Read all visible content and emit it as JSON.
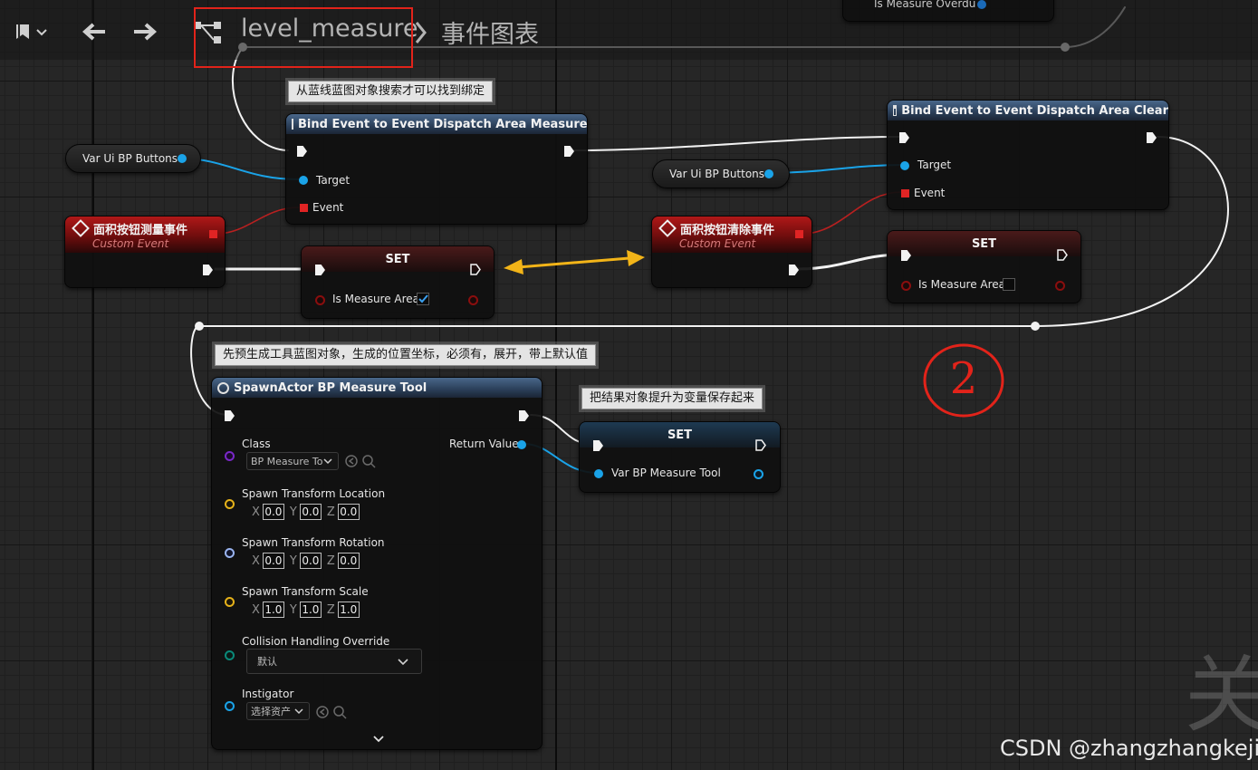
{
  "breadcrumb": {
    "blueprint_name": "level_measure",
    "graph_name": "事件图表"
  },
  "nodes": {
    "bind_measure": {
      "title": "Bind Event to Event Dispatch Area Measure",
      "pin_target": "Target",
      "pin_event": "Event",
      "comment": "从蓝线蓝图对象搜索才可以找到绑定"
    },
    "bind_clear": {
      "title": "Bind Event to Event Dispatch Area Clear",
      "pin_target": "Target",
      "pin_event": "Event"
    },
    "var_ui_1": {
      "label": "Var Ui BP Buttons"
    },
    "var_ui_2": {
      "label": "Var Ui BP Buttons"
    },
    "event_measure": {
      "title": "面积按钮测量事件",
      "subtitle": "Custom Event"
    },
    "event_clear": {
      "title": "面积按钮清除事件",
      "subtitle": "Custom Event"
    },
    "set_measure_true": {
      "title": "SET",
      "pin_label": "Is Measure Area",
      "checked": true
    },
    "set_measure_false": {
      "title": "SET",
      "pin_label": "Is Measure Area",
      "checked": false
    },
    "spawn_actor": {
      "title": "SpawnActor BP Measure Tool",
      "comment": "先预生成工具蓝图对象，生成的位置坐标，必须有，展开，带上默认值",
      "class_label": "Class",
      "class_value": "BP Measure To",
      "return_label": "Return Value",
      "location_label": "Spawn Transform Location",
      "location": {
        "x": "0.0",
        "y": "0.0",
        "z": "0.0"
      },
      "rotation_label": "Spawn Transform Rotation",
      "rotation": {
        "x": "0.0",
        "y": "0.0",
        "z": "0.0"
      },
      "scale_label": "Spawn Transform Scale",
      "scale": {
        "x": "1.0",
        "y": "1.0",
        "z": "1.0"
      },
      "collision_label": "Collision Handling Override",
      "collision_value": "默认",
      "instigator_label": "Instigator",
      "instigator_value": "选择资产",
      "axis_x": "X",
      "axis_y": "Y",
      "axis_z": "Z"
    },
    "set_tool": {
      "title": "SET",
      "pin_label": "Var BP Measure Tool",
      "comment": "把结果对象提升为变量保存起来"
    }
  },
  "top_partial_node": {
    "label": "Is Measure Overdu"
  },
  "annotation": {
    "circled_number": "2"
  },
  "watermark": {
    "text": "CSDN @zhangzhangkeji",
    "corner_glyph": "关"
  },
  "colors": {
    "exec_wire": "#f2f2f2",
    "object_pin": "#1aa3e8",
    "delegate_pin": "#e02424",
    "class_pin": "#7a28c8",
    "vector_pin": "#e6b21a",
    "rotator_pin": "#9ab4f0",
    "enum_pin": "#0a8a7a",
    "bool_pin": "#8a0e0e",
    "annotation_red": "#e2231a",
    "arrow_yellow": "#f2b418"
  }
}
